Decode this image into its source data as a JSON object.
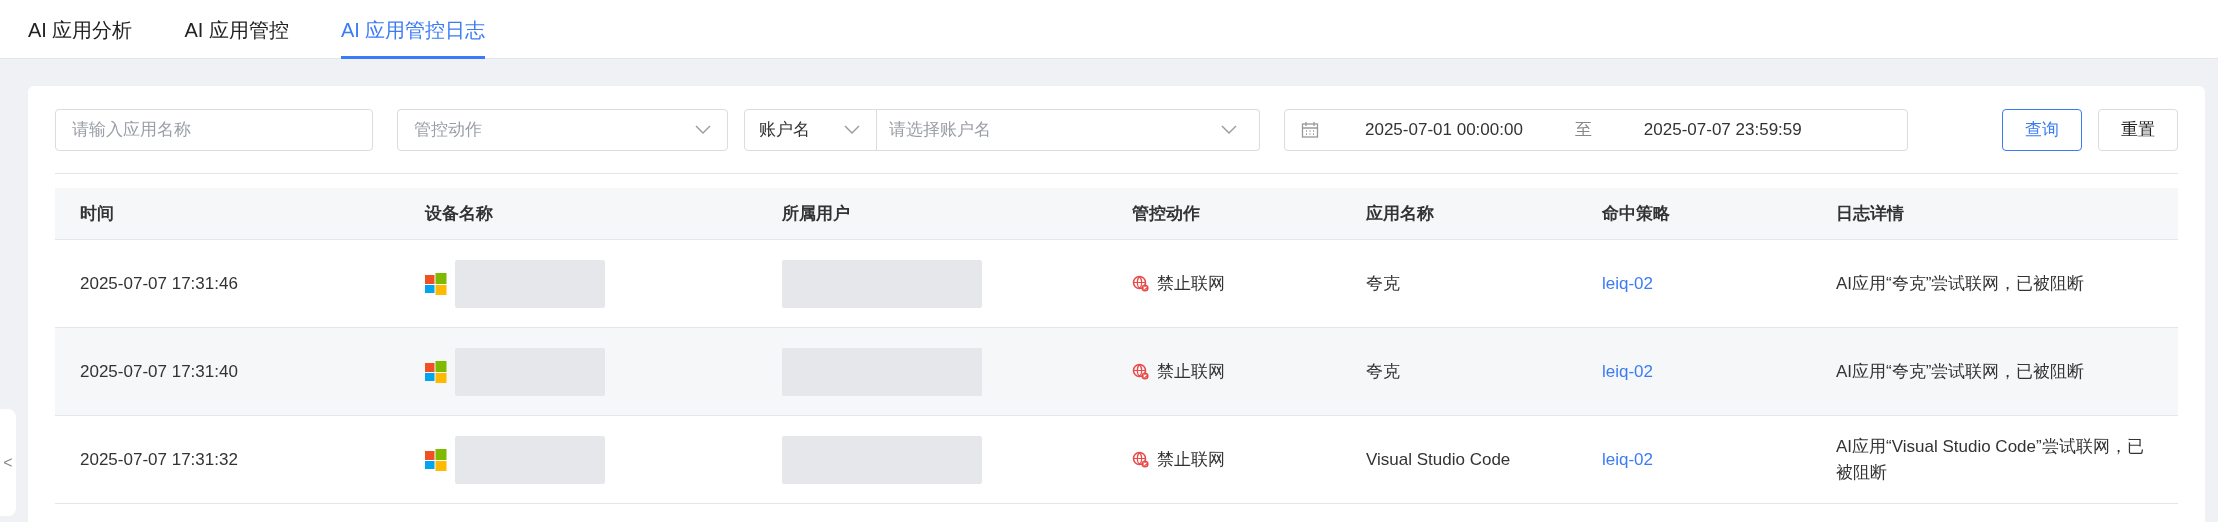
{
  "tabs": [
    {
      "label": "AI 应用分析",
      "selected": false
    },
    {
      "label": "AI 应用管控",
      "selected": false
    },
    {
      "label": "AI 应用管控日志",
      "selected": true
    }
  ],
  "filters": {
    "app_name": {
      "placeholder": "请输入应用名称"
    },
    "action": {
      "placeholder": "管控动作"
    },
    "account_type": {
      "value": "账户名"
    },
    "account": {
      "placeholder": "请选择账户名"
    },
    "date_range": {
      "start": "2025-07-01 00:00:00",
      "separator": "至",
      "end": "2025-07-07 23:59:59"
    }
  },
  "buttons": [
    {
      "label": "查询",
      "kind": "primary"
    },
    {
      "label": "重置",
      "kind": "default"
    }
  ],
  "table": {
    "columns": [
      "时间",
      "设备名称",
      "所属用户",
      "管控动作",
      "应用名称",
      "命中策略",
      "日志详情"
    ],
    "rows": [
      {
        "time": "2025-07-07 17:31:46",
        "action": "禁止联网",
        "app": "夸克",
        "policy": "leiq-02",
        "detail": "AI应用“夸克”尝试联网，已被阻断"
      },
      {
        "time": "2025-07-07 17:31:40",
        "action": "禁止联网",
        "app": "夸克",
        "policy": "leiq-02",
        "detail": "AI应用“夸克”尝试联网，已被阻断"
      },
      {
        "time": "2025-07-07 17:31:32",
        "action": "禁止联网",
        "app": "Visual Studio Code",
        "policy": "leiq-02",
        "detail": "AI应用“Visual Studio Code”尝试联网，已被阻断"
      }
    ]
  },
  "sidebar_toggle": {
    "label": "<"
  }
}
